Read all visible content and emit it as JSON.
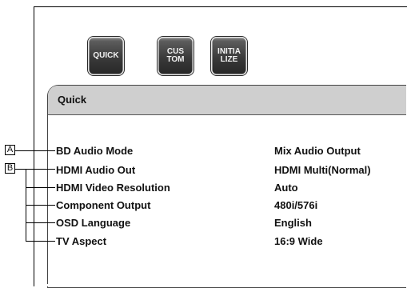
{
  "tabs": [
    {
      "label": "QUICK"
    },
    {
      "label": "CUS\nTOM"
    },
    {
      "label": "INITIA\nLIZE"
    }
  ],
  "panel": {
    "title": "Quick"
  },
  "settings": [
    {
      "label": "BD Audio Mode",
      "value": "Mix Audio Output"
    },
    {
      "label": "HDMI Audio Out",
      "value": "HDMI Multi(Normal)"
    },
    {
      "label": "HDMI Video Resolution",
      "value": "Auto"
    },
    {
      "label": "Component Output",
      "value": "480i/576i"
    },
    {
      "label": "OSD Language",
      "value": "English"
    },
    {
      "label": "TV Aspect",
      "value": "16:9 Wide"
    }
  ],
  "callouts": {
    "a": "A",
    "b": "B"
  }
}
